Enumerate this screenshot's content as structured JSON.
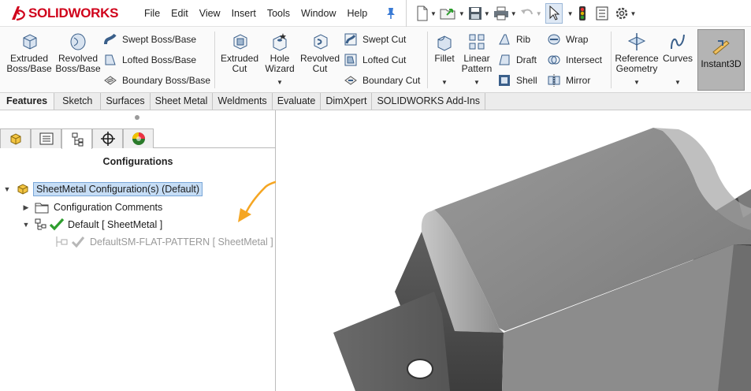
{
  "app": {
    "brand_ds": "DS",
    "brand_name": "SOLIDWORKS"
  },
  "menu": [
    "File",
    "Edit",
    "View",
    "Insert",
    "Tools",
    "Window",
    "Help"
  ],
  "ribbon": {
    "extruded_boss": "Extruded\nBoss/Base",
    "revolved_boss": "Revolved\nBoss/Base",
    "swept_boss": "Swept Boss/Base",
    "lofted_boss": "Lofted Boss/Base",
    "boundary_boss": "Boundary Boss/Base",
    "extruded_cut": "Extruded\nCut",
    "hole_wizard": "Hole\nWizard",
    "revolved_cut": "Revolved\nCut",
    "swept_cut": "Swept Cut",
    "lofted_cut": "Lofted Cut",
    "boundary_cut": "Boundary Cut",
    "fillet": "Fillet",
    "linear_pattern": "Linear\nPattern",
    "rib": "Rib",
    "draft": "Draft",
    "shell": "Shell",
    "wrap": "Wrap",
    "intersect": "Intersect",
    "mirror": "Mirror",
    "reference_geometry": "Reference\nGeometry",
    "curves": "Curves",
    "instant3d": "Instant3D"
  },
  "tabs": [
    "Features",
    "Sketch",
    "Surfaces",
    "Sheet Metal",
    "Weldments",
    "Evaluate",
    "DimXpert",
    "SOLIDWORKS Add-Ins"
  ],
  "panel": {
    "title": "Configurations",
    "tree": {
      "root": "SheetMetal Configuration(s)  (Default)",
      "comments": "Configuration Comments",
      "default": "Default [ SheetMetal ]",
      "flat": "DefaultSM-FLAT-PATTERN [ SheetMetal ]"
    }
  },
  "colors": {
    "accent_arrow": "#f5a623",
    "brand_red": "#d0021b",
    "selection": "#c6ddf5",
    "check_green": "#2e9e2e"
  }
}
